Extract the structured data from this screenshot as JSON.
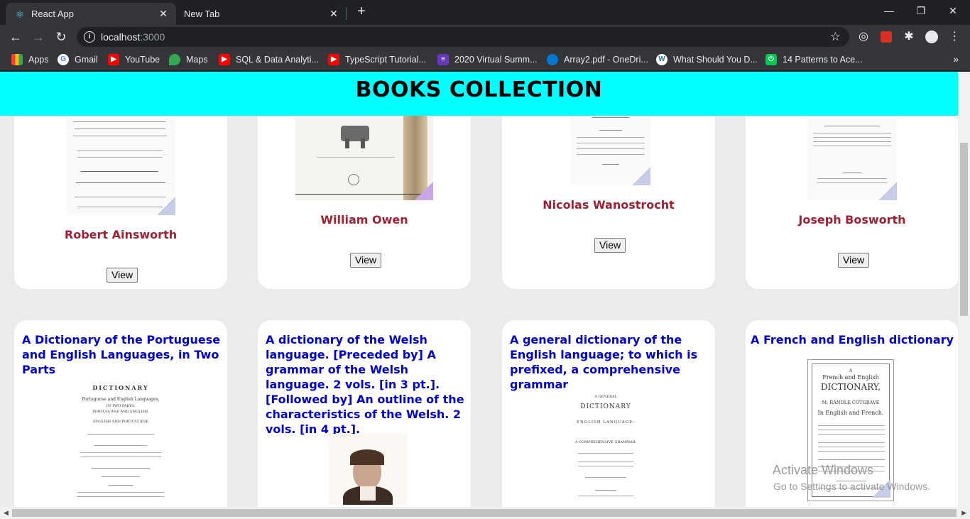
{
  "browser": {
    "tabs": [
      {
        "label": "React App",
        "icon": "react-icon",
        "close": "✕"
      },
      {
        "label": "New Tab",
        "close": "✕"
      }
    ],
    "new_tab": "+",
    "window": {
      "minimize": "—",
      "restore": "❐",
      "close": "✕"
    },
    "nav": {
      "back": "←",
      "forward": "→",
      "reload": "↻"
    },
    "url_host": "localhost",
    "url_port": ":3000",
    "star": "☆",
    "bookmarks": [
      {
        "label": "Apps",
        "icon": "apps-grid-icon",
        "color": "#ea4335"
      },
      {
        "label": "Gmail",
        "icon": "google-icon",
        "color": "#ffffff"
      },
      {
        "label": "YouTube",
        "icon": "youtube-icon",
        "color": "#ff0000"
      },
      {
        "label": "Maps",
        "icon": "maps-icon",
        "color": "#34a853"
      },
      {
        "label": "SQL & Data Analyti...",
        "icon": "youtube-icon",
        "color": "#ff0000"
      },
      {
        "label": "TypeScript Tutorial...",
        "icon": "youtube-icon",
        "color": "#ff0000"
      },
      {
        "label": "2020 Virtual Summ...",
        "icon": "forms-icon",
        "color": "#673ab7"
      },
      {
        "label": "Array2.pdf - OneDri...",
        "icon": "onedrive-icon",
        "color": "#0078d4"
      },
      {
        "label": "What Should You D...",
        "icon": "wordpress-icon",
        "color": "#ffffff"
      },
      {
        "label": "14 Patterns to Ace...",
        "icon": "power-icon",
        "color": "#00c853"
      }
    ],
    "bookmarks_more": "»"
  },
  "page": {
    "heading": "BOOKS COLLECTION",
    "row1": [
      {
        "author": "Robert Ainsworth",
        "button": "View"
      },
      {
        "author": "William Owen",
        "button": "View"
      },
      {
        "author": "Nicolas Wanostrocht",
        "button": "View"
      },
      {
        "author": "Joseph Bosworth",
        "button": "View"
      }
    ],
    "row2": [
      {
        "title": "A Dictionary of the Portuguese and English Languages, in Two Parts"
      },
      {
        "title": "A dictionary of the Welsh language. [Preceded by] A grammar of the Welsh language. 2 vols. [in 3 pt.]. [Followed by] An outline of the characteristics of the Welsh. 2 vols. [in 4 pt.]."
      },
      {
        "title": "A general dictionary of the English language; to which is prefixed, a comprehensive grammar"
      },
      {
        "title": "A French and English dictionary"
      }
    ],
    "book_scans": {
      "b1": [
        "DICTIONARY",
        "Portuguese and English Languages,",
        "IN TWO PARTS,",
        "PORTUGUESE AND ENGLISH,",
        "ENGLISH AND PORTUGUESE"
      ],
      "b3": [
        "A GENERAL",
        "DICTIONARY",
        "ENGLISH LANGUAGE;",
        "A COMPREHENSIVE GRAMMAR."
      ],
      "b4": [
        "A",
        "French and English",
        "DICTIONARY,",
        "M. RANDLE COTGRAVE",
        "In English and French."
      ]
    }
  },
  "watermark": {
    "line1": "Activate Windows",
    "line2": "Go to Settings to activate Windows."
  }
}
